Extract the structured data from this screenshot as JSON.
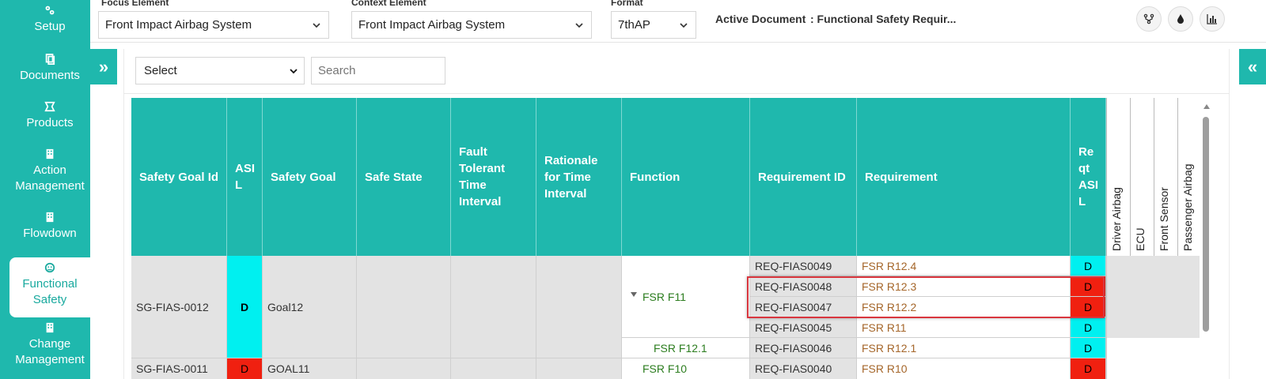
{
  "sidebar": {
    "items": [
      {
        "label": "Setup",
        "icon": "gears-icon"
      },
      {
        "label": "Documents",
        "icon": "documents-icon"
      },
      {
        "label": "Products",
        "icon": "products-icon"
      },
      {
        "label": "Action Management",
        "icon": "building-icon"
      },
      {
        "label": "Flowdown",
        "icon": "building-icon"
      },
      {
        "label": "Functional Safety",
        "icon": "safety-icon",
        "active": true
      },
      {
        "label": "Change Management",
        "icon": "building-icon"
      }
    ]
  },
  "header": {
    "focus_label": "Focus Element",
    "focus_value": "Front Impact Airbag System",
    "context_label": "Context Element",
    "context_value": "Front Impact Airbag System",
    "format_label": "Format",
    "format_value": "7thAP",
    "active_doc_label": "Active Document",
    "active_doc_value": ": Functional Safety Requir..."
  },
  "toggles": {
    "left": "»",
    "right": "«"
  },
  "filter": {
    "select_value": "Select",
    "search_placeholder": "Search"
  },
  "table": {
    "headers": {
      "safety_goal_id": "Safety Goal Id",
      "asil": "ASI L",
      "safety_goal": "Safety Goal",
      "safe_state": "Safe State",
      "ftti": "Fault Tolerant Time Interval",
      "rationale": "Rationale for Time Interval",
      "function": "Function",
      "requirement_id": "Requirement ID",
      "requirement": "Requirement",
      "req_asil": "Re qt ASI L",
      "driver_airbag": "Driver Airbag",
      "ecu": "ECU",
      "front_sensor": "Front Sensor",
      "passenger_airbag": "Passenger Airbag"
    },
    "goals": [
      {
        "id": "SG-FIAS-0012",
        "asil": "D",
        "goal": "Goal12"
      },
      {
        "id": "SG-FIAS-0011",
        "asil": "D",
        "goal": "GOAL11"
      }
    ],
    "functions": [
      "FSR F11",
      "FSR F12.1",
      "FSR F10"
    ],
    "rows": [
      {
        "req_id": "REQ-FIAS0049",
        "req": "FSR R12.4",
        "asil": "D"
      },
      {
        "req_id": "REQ-FIAS0048",
        "req": "FSR R12.3",
        "asil": "D"
      },
      {
        "req_id": "REQ-FIAS0047",
        "req": "FSR R12.2",
        "asil": "D"
      },
      {
        "req_id": "REQ-FIAS0045",
        "req": "FSR R11",
        "asil": "D"
      },
      {
        "req_id": "REQ-FIAS0046",
        "req": "FSR R12.1",
        "asil": "D"
      },
      {
        "req_id": "REQ-FIAS0040",
        "req": "FSR R10",
        "asil": "D"
      }
    ]
  },
  "colors": {
    "accent": "#1fb8ad",
    "asil_cyan": "#00f0f0",
    "asil_red": "#f02010",
    "highlight": "#d9363e"
  }
}
